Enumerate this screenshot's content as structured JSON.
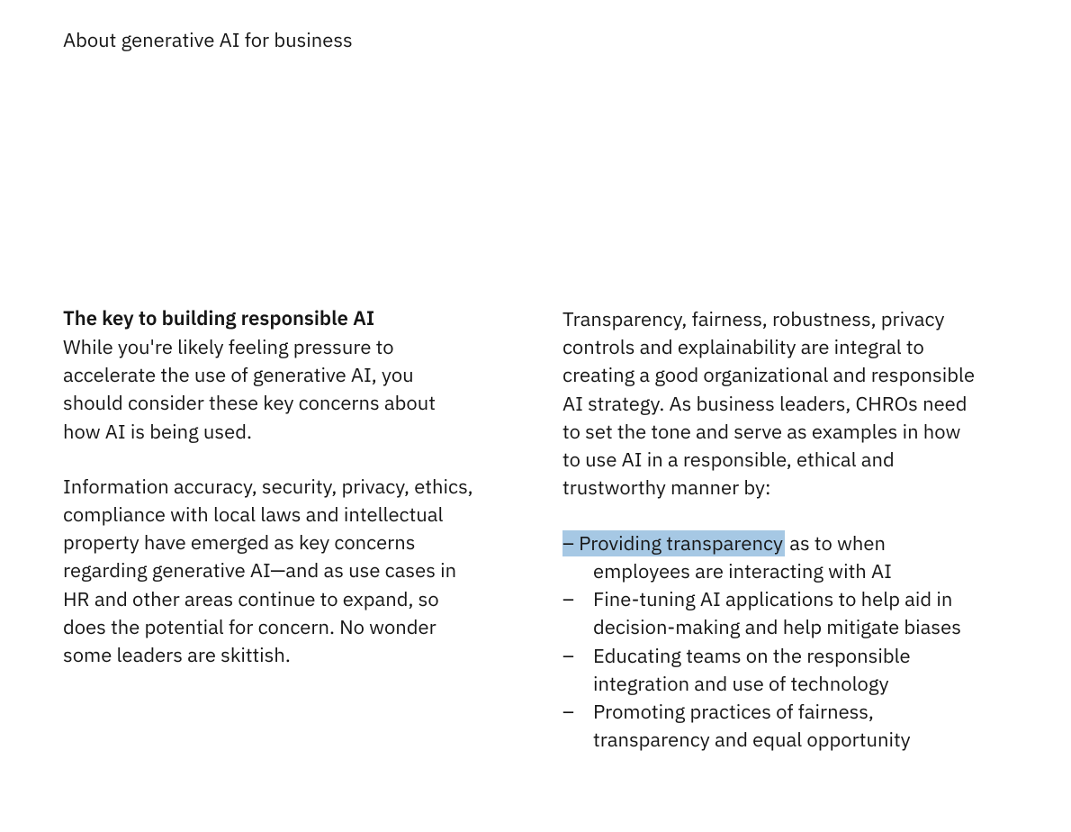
{
  "header": "About generative AI for business",
  "left": {
    "subhead": "The key to building responsible AI",
    "para1": "While you're likely feeling pressure to accelerate the use of generative AI, you should consider these key concerns about how AI is being used.",
    "para2": "Information accuracy, security, privacy, ethics, compliance with local laws and intellectual property have emerged as key concerns regarding generative AI—and as use cases in HR and other areas continue to expand, so does the potential for concern. No wonder some leaders are skittish."
  },
  "right": {
    "para1": "Transparency, fairness, robustness, privacy controls and explainability are integral to creating a good organizational and responsible AI strategy. As business leaders, CHROs need to set the tone and serve as examples in how to use AI in a responsible, ethical and trustworthy manner by:",
    "bullets": {
      "dash": "–",
      "b1_hl_prefix": "–  Providing transparency",
      "b1_rest": " as to when employees are interacting with AI",
      "b2": "Fine-tuning AI applications to help aid in decision-making and help mitigate biases",
      "b3": "Educating teams on the responsible integration and use of technology",
      "b4": "Promoting practices of fairness, transparency and equal opportunity"
    }
  }
}
